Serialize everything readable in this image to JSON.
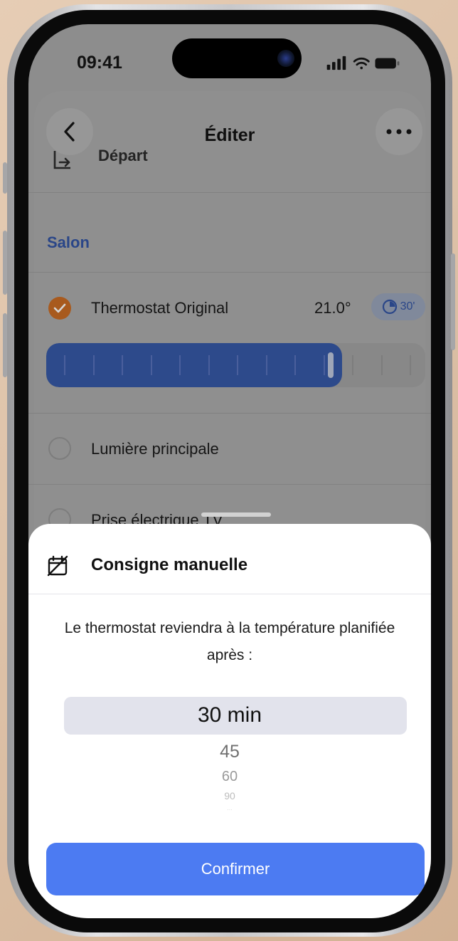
{
  "status_bar": {
    "time": "09:41"
  },
  "nav": {
    "title": "Éditer",
    "back_icon": "chevron-left-icon",
    "more_icon": "ellipsis-icon"
  },
  "background_list": {
    "departure_label": "Départ",
    "section_title": "Salon",
    "devices": [
      {
        "label": "Thermostat Original",
        "checked": true,
        "temperature": "21.0°",
        "timer": "30'",
        "setpoint_fraction": 0.78
      },
      {
        "label": "Lumière principale",
        "checked": false
      },
      {
        "label": "Prise électrique TV",
        "checked": false
      }
    ]
  },
  "sheet": {
    "title": "Consigne manuelle",
    "title_icon": "calendar-off-icon",
    "description": "Le thermostat reviendra à la température planifiée après :",
    "picker": {
      "selected": "30 min",
      "options_below": [
        "45",
        "60",
        "90",
        "..."
      ]
    },
    "confirm_label": "Confirmer"
  },
  "colors": {
    "accent": "#4c7bf2",
    "check_active": "#e07a2c",
    "slider_fill": "#3c64ba"
  }
}
